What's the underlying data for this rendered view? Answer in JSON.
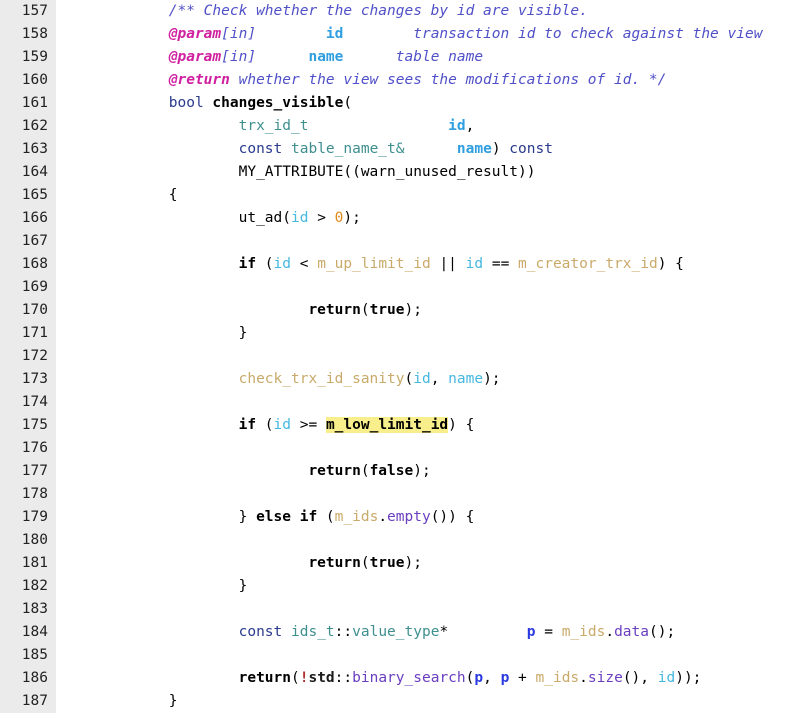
{
  "editor": {
    "name": "code-viewer",
    "language": "C++",
    "first_line": 157,
    "last_line": 187,
    "gutter_bg": "#ebebeb",
    "background": "#ffffff",
    "search_highlight_color": "#f9ee8c",
    "search_highlight_term": "m_low_limit_id"
  },
  "lines": [
    {
      "number": "157",
      "tokens": [
        {
          "text": "            ",
          "cls": "t-plain"
        },
        {
          "text": "/** Check whether the changes by id are visible.",
          "cls": "t-comment"
        }
      ]
    },
    {
      "number": "158",
      "tokens": [
        {
          "text": "            ",
          "cls": "t-plain"
        },
        {
          "text": "@param",
          "cls": "t-doctag"
        },
        {
          "text": "[in]",
          "cls": "t-comment"
        },
        {
          "text": "        ",
          "cls": "t-plain"
        },
        {
          "text": "id",
          "cls": "t-docparam"
        },
        {
          "text": "        ",
          "cls": "t-plain"
        },
        {
          "text": "transaction id to check against the view",
          "cls": "t-comment"
        }
      ]
    },
    {
      "number": "159",
      "tokens": [
        {
          "text": "            ",
          "cls": "t-plain"
        },
        {
          "text": "@param",
          "cls": "t-doctag"
        },
        {
          "text": "[in]",
          "cls": "t-comment"
        },
        {
          "text": "      ",
          "cls": "t-plain"
        },
        {
          "text": "name",
          "cls": "t-docparam"
        },
        {
          "text": "      ",
          "cls": "t-plain"
        },
        {
          "text": "table name",
          "cls": "t-comment"
        }
      ]
    },
    {
      "number": "160",
      "tokens": [
        {
          "text": "            ",
          "cls": "t-plain"
        },
        {
          "text": "@return",
          "cls": "t-doctag"
        },
        {
          "text": " whether the view sees the modifications of id. */",
          "cls": "t-comment"
        }
      ]
    },
    {
      "number": "161",
      "tokens": [
        {
          "text": "            ",
          "cls": "t-plain"
        },
        {
          "text": "bool",
          "cls": "t-keyword"
        },
        {
          "text": " ",
          "cls": "t-plain"
        },
        {
          "text": "changes_visible",
          "cls": "t-fname"
        },
        {
          "text": "(",
          "cls": "t-plain"
        }
      ]
    },
    {
      "number": "162",
      "tokens": [
        {
          "text": "                    ",
          "cls": "t-plain"
        },
        {
          "text": "trx_id_t",
          "cls": "t-type"
        },
        {
          "text": "                ",
          "cls": "t-plain"
        },
        {
          "text": "id",
          "cls": "t-var"
        },
        {
          "text": ",",
          "cls": "t-plain"
        }
      ]
    },
    {
      "number": "163",
      "tokens": [
        {
          "text": "                    ",
          "cls": "t-plain"
        },
        {
          "text": "const",
          "cls": "t-keyword"
        },
        {
          "text": " ",
          "cls": "t-plain"
        },
        {
          "text": "table_name_t&",
          "cls": "t-type"
        },
        {
          "text": "      ",
          "cls": "t-plain"
        },
        {
          "text": "name",
          "cls": "t-var"
        },
        {
          "text": ") ",
          "cls": "t-plain"
        },
        {
          "text": "const",
          "cls": "t-keyword"
        }
      ]
    },
    {
      "number": "164",
      "tokens": [
        {
          "text": "                    ",
          "cls": "t-plain"
        },
        {
          "text": "MY_ATTRIBUTE((warn_unused_result))",
          "cls": "t-macro"
        }
      ]
    },
    {
      "number": "165",
      "tokens": [
        {
          "text": "            ",
          "cls": "t-plain"
        },
        {
          "text": "{",
          "cls": "t-plain"
        }
      ]
    },
    {
      "number": "166",
      "tokens": [
        {
          "text": "                    ",
          "cls": "t-plain"
        },
        {
          "text": "ut_ad",
          "cls": "t-macro"
        },
        {
          "text": "(",
          "cls": "t-plain"
        },
        {
          "text": "id",
          "cls": "t-ident"
        },
        {
          "text": " > ",
          "cls": "t-plain"
        },
        {
          "text": "0",
          "cls": "t-number"
        },
        {
          "text": ");",
          "cls": "t-plain"
        }
      ]
    },
    {
      "number": "167",
      "tokens": []
    },
    {
      "number": "168",
      "tokens": [
        {
          "text": "                    ",
          "cls": "t-plain"
        },
        {
          "text": "if",
          "cls": "t-kw-bold"
        },
        {
          "text": " (",
          "cls": "t-plain"
        },
        {
          "text": "id",
          "cls": "t-ident"
        },
        {
          "text": " < ",
          "cls": "t-plain"
        },
        {
          "text": "m_up_limit_id",
          "cls": "t-member"
        },
        {
          "text": " || ",
          "cls": "t-plain"
        },
        {
          "text": "id",
          "cls": "t-ident"
        },
        {
          "text": " == ",
          "cls": "t-plain"
        },
        {
          "text": "m_creator_trx_id",
          "cls": "t-member"
        },
        {
          "text": ") {",
          "cls": "t-plain"
        }
      ]
    },
    {
      "number": "169",
      "tokens": []
    },
    {
      "number": "170",
      "tokens": [
        {
          "text": "                            ",
          "cls": "t-plain"
        },
        {
          "text": "return",
          "cls": "t-kw-bold"
        },
        {
          "text": "(",
          "cls": "t-plain"
        },
        {
          "text": "true",
          "cls": "t-kw-bold"
        },
        {
          "text": ");",
          "cls": "t-plain"
        }
      ]
    },
    {
      "number": "171",
      "tokens": [
        {
          "text": "                    ",
          "cls": "t-plain"
        },
        {
          "text": "}",
          "cls": "t-plain"
        }
      ]
    },
    {
      "number": "172",
      "tokens": []
    },
    {
      "number": "173",
      "tokens": [
        {
          "text": "                    ",
          "cls": "t-plain"
        },
        {
          "text": "check_trx_id_sanity",
          "cls": "t-member"
        },
        {
          "text": "(",
          "cls": "t-plain"
        },
        {
          "text": "id",
          "cls": "t-ident"
        },
        {
          "text": ", ",
          "cls": "t-plain"
        },
        {
          "text": "name",
          "cls": "t-ident"
        },
        {
          "text": ");",
          "cls": "t-plain"
        }
      ]
    },
    {
      "number": "174",
      "tokens": []
    },
    {
      "number": "175",
      "tokens": [
        {
          "text": "                    ",
          "cls": "t-plain"
        },
        {
          "text": "if",
          "cls": "t-kw-bold"
        },
        {
          "text": " (",
          "cls": "t-plain"
        },
        {
          "text": "id",
          "cls": "t-ident"
        },
        {
          "text": " >= ",
          "cls": "t-plain"
        },
        {
          "text": "m_low_limit_id",
          "cls": "hl-search"
        },
        {
          "text": ") {",
          "cls": "t-plain"
        }
      ]
    },
    {
      "number": "176",
      "tokens": []
    },
    {
      "number": "177",
      "tokens": [
        {
          "text": "                            ",
          "cls": "t-plain"
        },
        {
          "text": "return",
          "cls": "t-kw-bold"
        },
        {
          "text": "(",
          "cls": "t-plain"
        },
        {
          "text": "false",
          "cls": "t-kw-bold"
        },
        {
          "text": ");",
          "cls": "t-plain"
        }
      ]
    },
    {
      "number": "178",
      "tokens": []
    },
    {
      "number": "179",
      "tokens": [
        {
          "text": "                    ",
          "cls": "t-plain"
        },
        {
          "text": "} ",
          "cls": "t-plain"
        },
        {
          "text": "else if",
          "cls": "t-kw-bold"
        },
        {
          "text": " (",
          "cls": "t-plain"
        },
        {
          "text": "m_ids",
          "cls": "t-member"
        },
        {
          "text": ".",
          "cls": "t-plain"
        },
        {
          "text": "empty",
          "cls": "t-method"
        },
        {
          "text": "()) {",
          "cls": "t-plain"
        }
      ]
    },
    {
      "number": "180",
      "tokens": []
    },
    {
      "number": "181",
      "tokens": [
        {
          "text": "                            ",
          "cls": "t-plain"
        },
        {
          "text": "return",
          "cls": "t-kw-bold"
        },
        {
          "text": "(",
          "cls": "t-plain"
        },
        {
          "text": "true",
          "cls": "t-kw-bold"
        },
        {
          "text": ");",
          "cls": "t-plain"
        }
      ]
    },
    {
      "number": "182",
      "tokens": [
        {
          "text": "                    ",
          "cls": "t-plain"
        },
        {
          "text": "}",
          "cls": "t-plain"
        }
      ]
    },
    {
      "number": "183",
      "tokens": []
    },
    {
      "number": "184",
      "tokens": [
        {
          "text": "                    ",
          "cls": "t-plain"
        },
        {
          "text": "const",
          "cls": "t-keyword"
        },
        {
          "text": " ",
          "cls": "t-plain"
        },
        {
          "text": "ids_t",
          "cls": "t-type"
        },
        {
          "text": "::",
          "cls": "t-plain"
        },
        {
          "text": "value_type",
          "cls": "t-type"
        },
        {
          "text": "*",
          "cls": "t-plain"
        },
        {
          "text": "         ",
          "cls": "t-plain"
        },
        {
          "text": "p",
          "cls": "t-pvar"
        },
        {
          "text": " = ",
          "cls": "t-plain"
        },
        {
          "text": "m_ids",
          "cls": "t-member"
        },
        {
          "text": ".",
          "cls": "t-plain"
        },
        {
          "text": "data",
          "cls": "t-method"
        },
        {
          "text": "();",
          "cls": "t-plain"
        }
      ]
    },
    {
      "number": "185",
      "tokens": []
    },
    {
      "number": "186",
      "tokens": [
        {
          "text": "                    ",
          "cls": "t-plain"
        },
        {
          "text": "return",
          "cls": "t-kw-bold"
        },
        {
          "text": "(",
          "cls": "t-plain"
        },
        {
          "text": "!",
          "cls": "t-bang"
        },
        {
          "text": "std",
          "cls": "t-std"
        },
        {
          "text": "::",
          "cls": "t-plain"
        },
        {
          "text": "binary_search",
          "cls": "t-method"
        },
        {
          "text": "(",
          "cls": "t-plain"
        },
        {
          "text": "p",
          "cls": "t-pvar"
        },
        {
          "text": ", ",
          "cls": "t-plain"
        },
        {
          "text": "p",
          "cls": "t-pvar"
        },
        {
          "text": " + ",
          "cls": "t-plain"
        },
        {
          "text": "m_ids",
          "cls": "t-member"
        },
        {
          "text": ".",
          "cls": "t-plain"
        },
        {
          "text": "size",
          "cls": "t-method"
        },
        {
          "text": "(), ",
          "cls": "t-plain"
        },
        {
          "text": "id",
          "cls": "t-ident"
        },
        {
          "text": "));",
          "cls": "t-plain"
        }
      ]
    },
    {
      "number": "187",
      "tokens": [
        {
          "text": "            ",
          "cls": "t-plain"
        },
        {
          "text": "}",
          "cls": "t-plain"
        }
      ]
    }
  ]
}
